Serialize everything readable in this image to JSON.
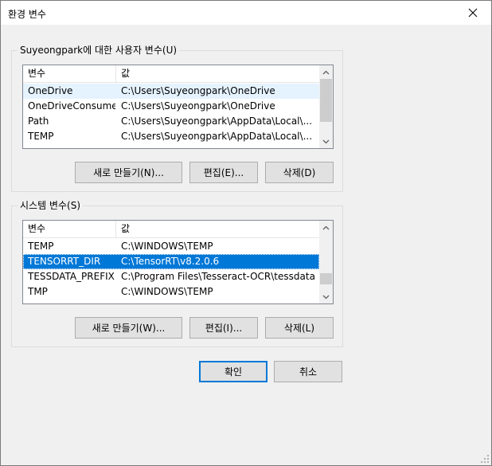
{
  "window": {
    "title": "환경 변수"
  },
  "user_group": {
    "label": "Suyeongpark에 대한 사용자 변수(U)",
    "columns": [
      "변수",
      "값"
    ],
    "rows": [
      {
        "name": "OneDrive",
        "value": "C:\\Users\\Suyeongpark\\OneDrive",
        "state": "hover"
      },
      {
        "name": "OneDriveConsumer",
        "value": "C:\\Users\\Suyeongpark\\OneDrive",
        "state": ""
      },
      {
        "name": "Path",
        "value": "C:\\Users\\Suyeongpark\\AppData\\Local\\...",
        "state": ""
      },
      {
        "name": "TEMP",
        "value": "C:\\Users\\Suyeongpark\\AppData\\Local\\...",
        "state": ""
      }
    ],
    "buttons": {
      "new": "새로 만들기(N)...",
      "edit": "편집(E)...",
      "delete": "삭제(D)"
    }
  },
  "system_group": {
    "label": "시스템 변수(S)",
    "columns": [
      "변수",
      "값"
    ],
    "rows": [
      {
        "name": "TEMP",
        "value": "C:\\WINDOWS\\TEMP",
        "state": ""
      },
      {
        "name": "TENSORRT_DIR",
        "value": "C:\\TensorRT\\v8.2.0.6",
        "state": "selected"
      },
      {
        "name": "TESSDATA_PREFIX",
        "value": "C:\\Program Files\\Tesseract-OCR\\tessdata",
        "state": ""
      },
      {
        "name": "TMP",
        "value": "C:\\WINDOWS\\TEMP",
        "state": ""
      }
    ],
    "buttons": {
      "new": "새로 만들기(W)...",
      "edit": "편집(I)...",
      "delete": "삭제(L)"
    }
  },
  "footer": {
    "ok": "확인",
    "cancel": "취소"
  },
  "colors": {
    "accent": "#0078d7",
    "selection_text": "#ffffff"
  }
}
